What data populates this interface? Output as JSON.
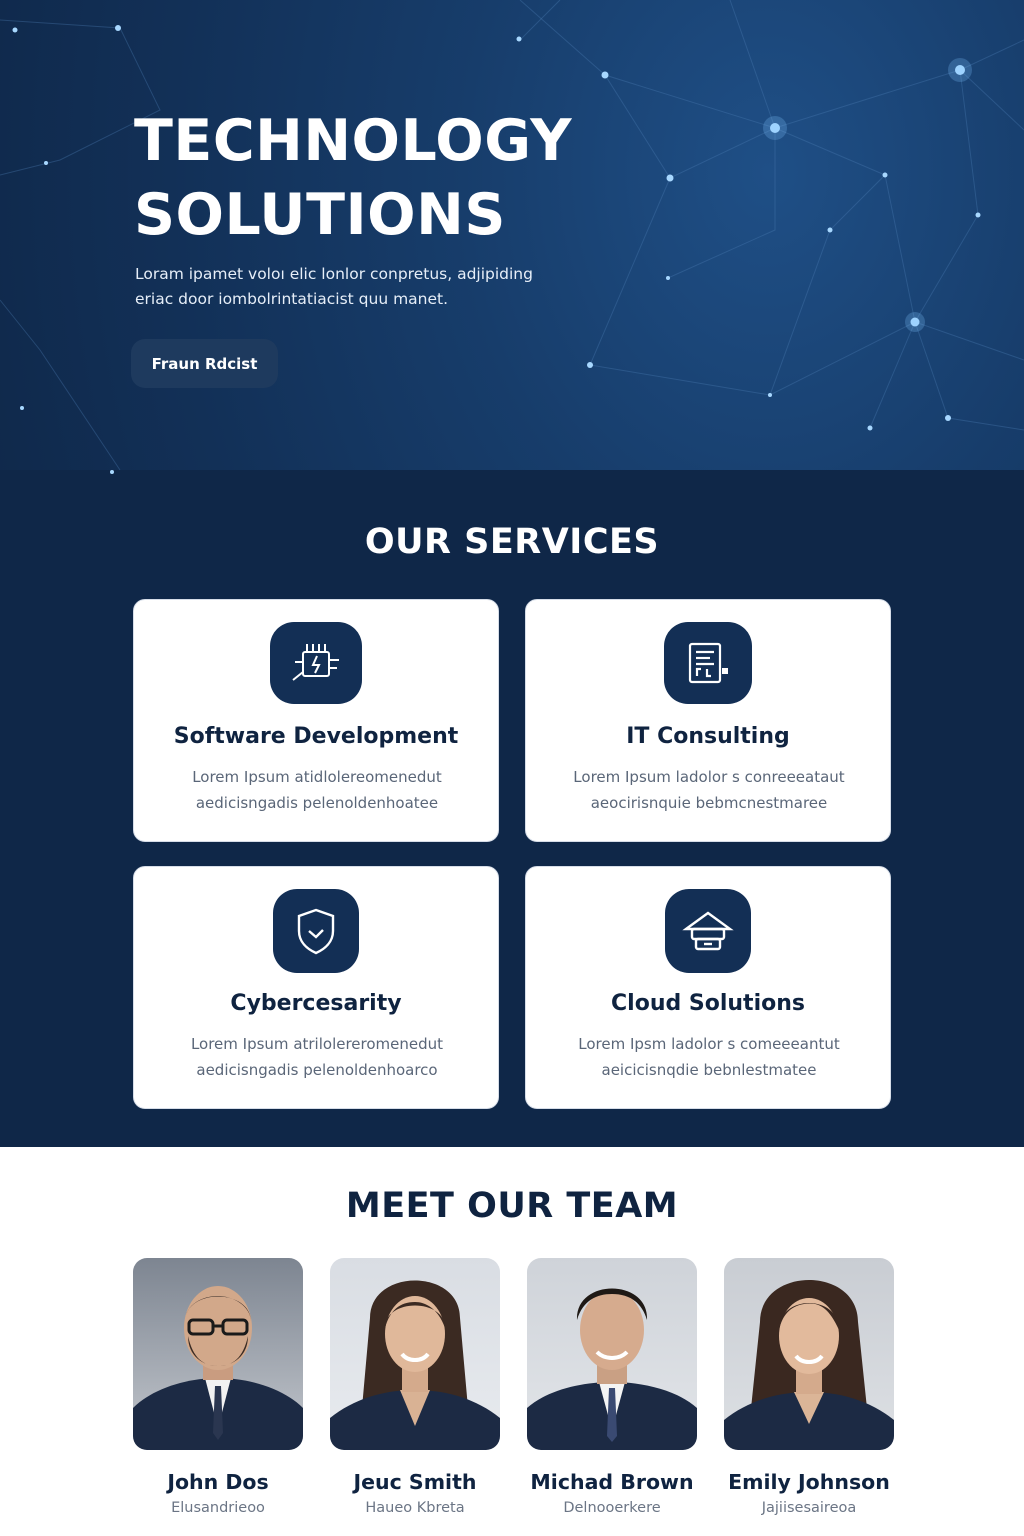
{
  "hero": {
    "title_line1": "TECHNOLOGY",
    "title_line2": "SOLUTIONS",
    "description": "Loram ipamet voloı elic lonlor conpretus, adjipiding eriac door iombolrintatiacist quu manet.",
    "button_label": "Fraun Rdcist"
  },
  "services": {
    "title": "OUR SERVICES",
    "items": [
      {
        "title": "Software Development",
        "description": "Lorem Ipsum atidlolereomenedut aedicisngadis pelenoldenhoatee",
        "icon": "chip-icon"
      },
      {
        "title": "IT Consulting",
        "description": "Lorem Ipsum ladolor s conreeeataut aeocirisnquie bebmcnestmaree",
        "icon": "document-board-icon"
      },
      {
        "title": "Cybercesarity",
        "description": "Lorem Ipsum atrilolereromenedut aedicisngadis pelenoldenhoarco",
        "icon": "shield-icon"
      },
      {
        "title": "Cloud Solutions",
        "description": "Lorem Ipsm ladolor s comeeeantut aeicicisnqdie bebnlestmatee",
        "icon": "cloud-home-icon"
      }
    ]
  },
  "team": {
    "title": "MEET OUR TEAM",
    "members": [
      {
        "name": "John Dos",
        "role": "Elusandrieoo"
      },
      {
        "name": "Jeuc Smith",
        "role": "Haueo Kbreta"
      },
      {
        "name": "Michad Brown",
        "role": "Delnooerkere"
      },
      {
        "name": "Emily Johnson",
        "role": "Jajiisesaireoa"
      }
    ]
  },
  "colors": {
    "hero_bg": "#123057",
    "navy": "#0f2748",
    "icon_bg": "#132f55",
    "star": "#7fc4ff"
  }
}
